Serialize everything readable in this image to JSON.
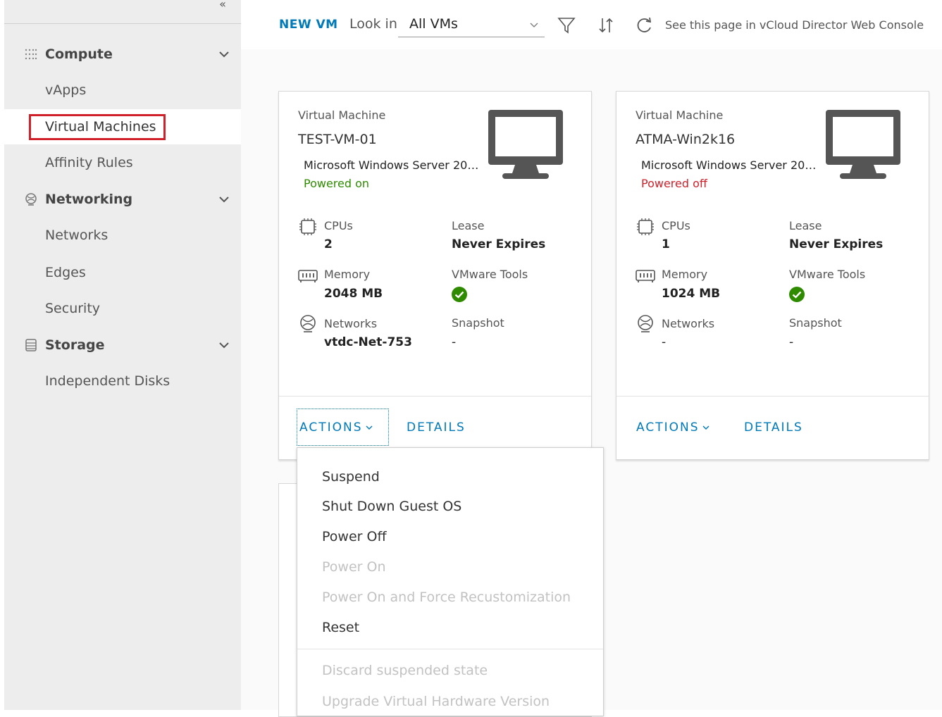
{
  "sidebar": {
    "groups": [
      {
        "label": "Compute",
        "icon": "grid-icon",
        "items": [
          "vApps",
          "Virtual Machines",
          "Affinity Rules"
        ]
      },
      {
        "label": "Networking",
        "icon": "network-icon",
        "items": [
          "Networks",
          "Edges",
          "Security"
        ]
      },
      {
        "label": "Storage",
        "icon": "storage-icon",
        "items": [
          "Independent Disks"
        ]
      }
    ],
    "active_item": "Virtual Machines",
    "highlight_color": "#d0212b"
  },
  "toolbar": {
    "new_vm": "NEW VM",
    "look_in_label": "Look in",
    "look_in_value": "All VMs",
    "filter_icon": "filter-icon",
    "sort_icon": "sort-icon",
    "refresh_icon": "refresh-icon",
    "web_console_link": "See this page in vCloud Director Web Console"
  },
  "cards": [
    {
      "kind": "Virtual Machine",
      "name": "TEST-VM-01",
      "os": "Microsoft Windows Server 20…",
      "status": "Powered on",
      "status_color": "#2e8b00",
      "cpus_label": "CPUs",
      "cpus": "2",
      "lease_label": "Lease",
      "lease": "Never Expires",
      "memory_label": "Memory",
      "memory": "2048 MB",
      "tools_label": "VMware Tools",
      "networks_label": "Networks",
      "networks": "vtdc-Net-753",
      "snapshot_label": "Snapshot",
      "snapshot": "-",
      "actions": "ACTIONS",
      "details": "DETAILS"
    },
    {
      "kind": "Virtual Machine",
      "name": "ATMA-Win2k16",
      "os": "Microsoft Windows Server 20…",
      "status": "Powered off",
      "status_color": "#d0212b",
      "cpus_label": "CPUs",
      "cpus": "1",
      "lease_label": "Lease",
      "lease": "Never Expires",
      "memory_label": "Memory",
      "memory": "1024 MB",
      "tools_label": "VMware Tools",
      "networks_label": "Networks",
      "networks": "-",
      "snapshot_label": "Snapshot",
      "snapshot": "-",
      "actions": "ACTIONS",
      "details": "DETAILS"
    }
  ],
  "actions_menu": {
    "items": [
      {
        "label": "Suspend",
        "enabled": true
      },
      {
        "label": "Shut Down Guest OS",
        "enabled": true
      },
      {
        "label": "Power Off",
        "enabled": true
      },
      {
        "label": "Power On",
        "enabled": false
      },
      {
        "label": "Power On and Force Recustomization",
        "enabled": false
      },
      {
        "label": "Reset",
        "enabled": true
      },
      {
        "label": "Discard suspended state",
        "enabled": false
      },
      {
        "label": "Upgrade Virtual Hardware Version",
        "enabled": false
      }
    ]
  },
  "colors": {
    "accent": "#0079b8",
    "tools_ok": "#2e8b00"
  }
}
